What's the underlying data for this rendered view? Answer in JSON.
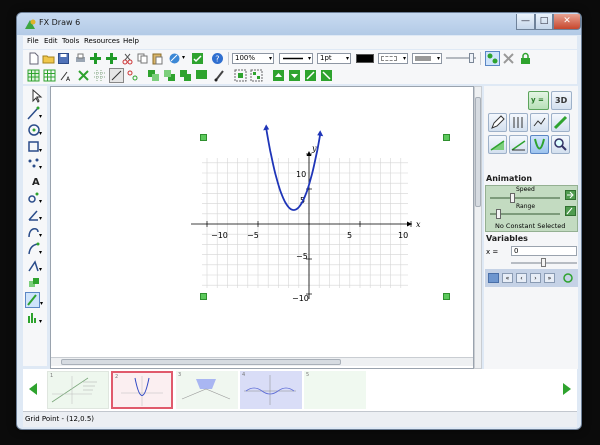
{
  "window": {
    "title": "FX Draw 6"
  },
  "window_buttons": {
    "minimize": "—",
    "maximize": "□",
    "close": "✕"
  },
  "menu": [
    "File",
    "Edit",
    "Tools",
    "Resources",
    "Help"
  ],
  "toolbar": {
    "zoom": "100%",
    "line_width": "1pt"
  },
  "graph": {
    "x_axis_label": "x",
    "y_axis_label": "y",
    "x_ticks": [
      "−10",
      "−5",
      "5",
      "10"
    ],
    "y_ticks": [
      "10",
      "5",
      "−5",
      "−10"
    ],
    "curve_color": "#1f35b8"
  },
  "right_panel": {
    "y_button": "y =",
    "threed_button": "3D",
    "animation_title": "Animation",
    "speed_label": "Speed",
    "range_label": "Range",
    "constant_status": "No Constant Selected",
    "variables_title": "Variables",
    "x_label": "x =",
    "x_value": "0"
  },
  "thumbnails": [
    {
      "number": "1",
      "selected": false
    },
    {
      "number": "2",
      "selected": true
    },
    {
      "number": "3",
      "selected": false
    },
    {
      "number": "4",
      "selected": false
    },
    {
      "number": "5",
      "selected": false
    }
  ],
  "status": {
    "text": "Grid Point - (12,0.5)"
  },
  "colors": {
    "accent_green": "#2ea32e",
    "selected_border": "#e05a6c",
    "panel_green": "#c3dbc1"
  }
}
